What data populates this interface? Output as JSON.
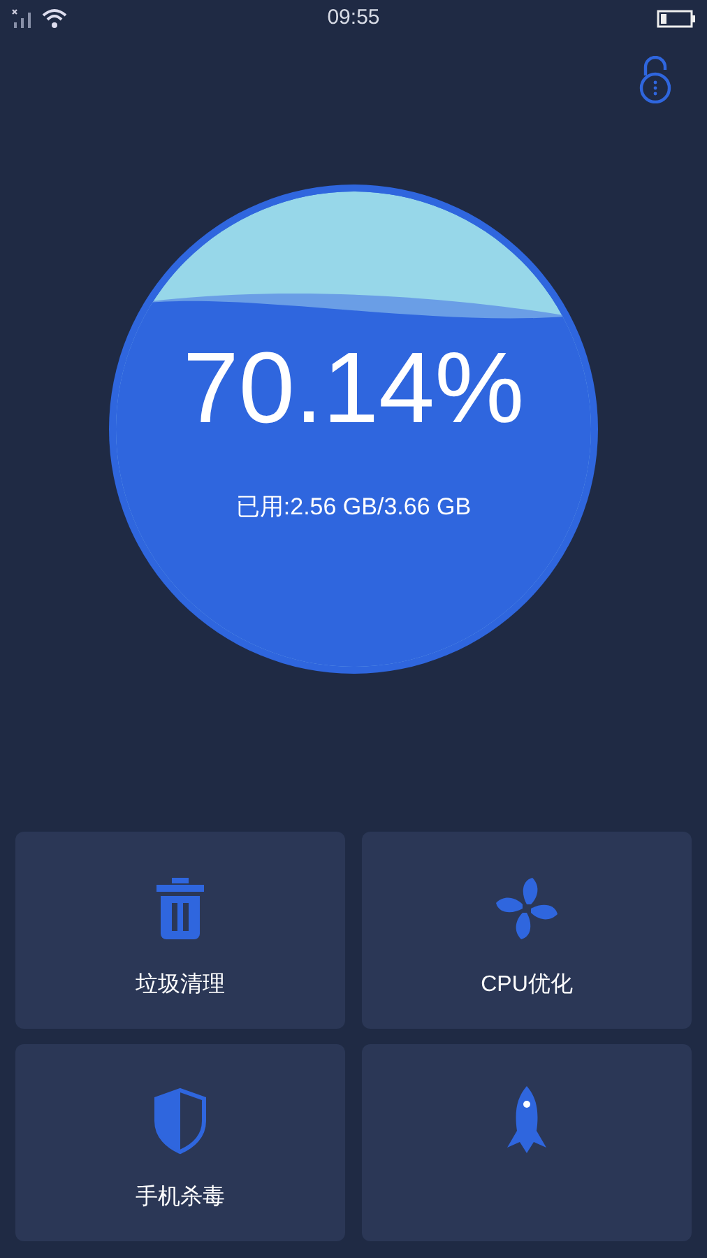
{
  "status_bar": {
    "time": "09:55"
  },
  "gauge": {
    "percent": "70.14%",
    "usage": "已用:2.56 GB/3.66 GB"
  },
  "tools": [
    {
      "kind": "trash",
      "label": "垃圾清理"
    },
    {
      "kind": "fan",
      "label": "CPU优化"
    },
    {
      "kind": "shield",
      "label": "手机杀毒"
    },
    {
      "kind": "rocket"
    }
  ]
}
